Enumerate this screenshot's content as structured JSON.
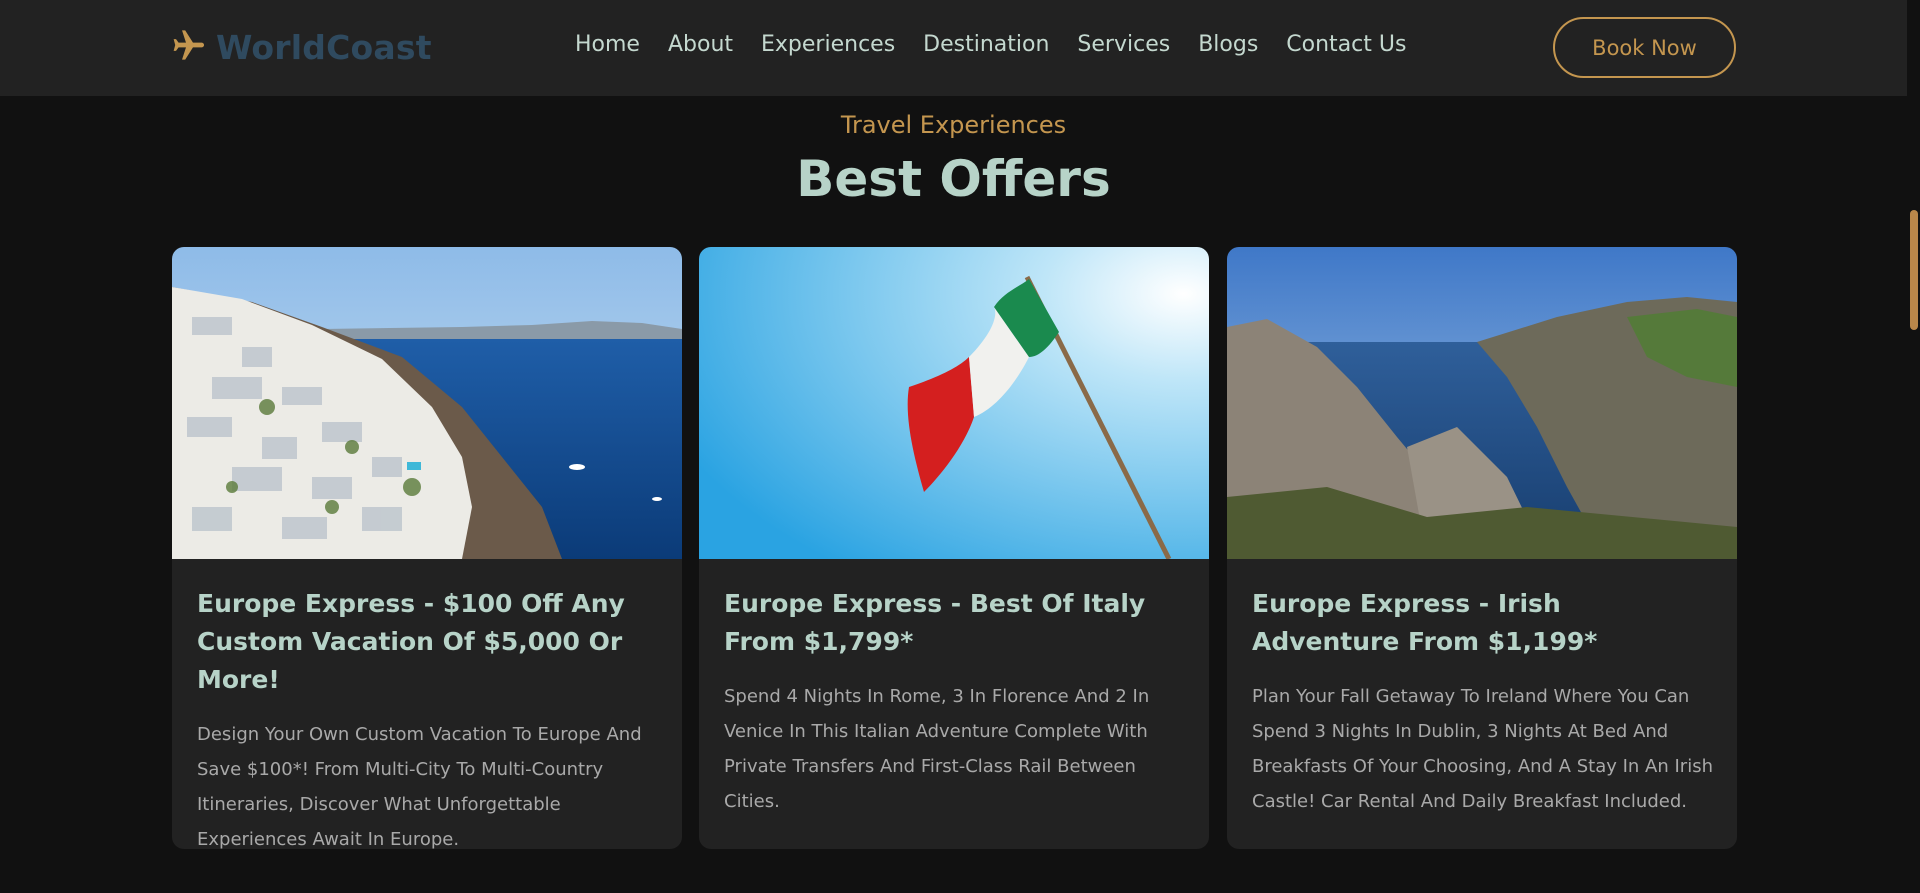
{
  "brand": {
    "name": "WorldCoast",
    "icon": "airplane-icon",
    "color": "#2f4a5f"
  },
  "nav": {
    "items": [
      "Home",
      "About",
      "Experiences",
      "Destination",
      "Services",
      "Blogs",
      "Contact Us"
    ],
    "book_label": "Book Now"
  },
  "section": {
    "eyebrow": "Travel Experiences",
    "title": "Best Offers"
  },
  "cards": [
    {
      "image": "santorini-coast-photo",
      "title": "Europe Express - $100 Off Any Custom Vacation Of $5,000 Or More!",
      "text": "Design Your Own Custom Vacation To Europe And Save $100*! From Multi-City To Multi-Country Itineraries, Discover What Unforgettable Experiences Await In Europe."
    },
    {
      "image": "italian-flag-photo",
      "title": "Europe Express - Best Of Italy From $1,799*",
      "text": "Spend 4 Nights In Rome, 3 In Florence And 2 In Venice In This Italian Adventure Complete With Private Transfers And First-Class Rail Between Cities."
    },
    {
      "image": "irish-cliffs-photo",
      "title": "Europe Express - Irish Adventure From $1,199*",
      "text": "Plan Your Fall Getaway To Ireland Where You Can Spend 3 Nights In Dublin, 3 Nights At Bed And Breakfasts Of Your Choosing, And A Stay In An Irish Castle! Car Rental And Daily Breakfast Included."
    }
  ],
  "colors": {
    "accent": "#c4964f",
    "heading": "#b7d3c8",
    "background": "#111111",
    "surface": "#222222"
  }
}
